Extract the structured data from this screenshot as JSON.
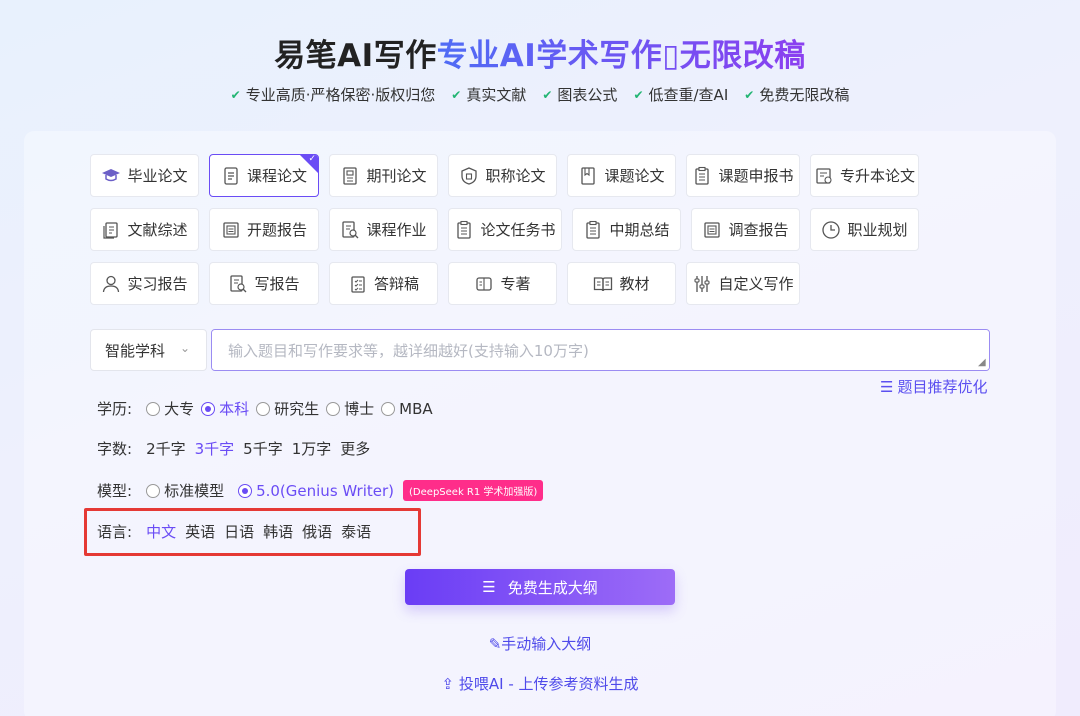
{
  "header": {
    "brand": "易笔AI写作",
    "tagline": "专业AI学术写作▯无限改稿",
    "features": [
      "专业高质·严格保密·版权归您",
      "真实文献",
      "图表公式",
      "低查重/查AI",
      "免费无限改稿"
    ]
  },
  "paper_types": [
    {
      "label": "毕业论文",
      "icon": "graduation-cap-icon",
      "active": false
    },
    {
      "label": "课程论文",
      "icon": "document-icon",
      "active": true
    },
    {
      "label": "期刊论文",
      "icon": "journal-icon",
      "active": false
    },
    {
      "label": "职称论文",
      "icon": "badge-icon",
      "active": false
    },
    {
      "label": "课题论文",
      "icon": "book-icon",
      "active": false
    },
    {
      "label": "课题申报书",
      "icon": "clipboard-icon",
      "active": false
    },
    {
      "label": "专升本论文",
      "icon": "certificate-icon",
      "active": false
    },
    {
      "label": "文献综述",
      "icon": "copy-icon",
      "active": false
    },
    {
      "label": "开题报告",
      "icon": "report-icon",
      "active": false
    },
    {
      "label": "课程作业",
      "icon": "search-document-icon",
      "active": false
    },
    {
      "label": "论文任务书",
      "icon": "checklist-icon",
      "active": false
    },
    {
      "label": "中期总结",
      "icon": "summary-icon",
      "active": false
    },
    {
      "label": "调查报告",
      "icon": "survey-icon",
      "active": false
    },
    {
      "label": "职业规划",
      "icon": "clock-icon",
      "active": false
    },
    {
      "label": "实习报告",
      "icon": "user-icon",
      "active": false
    },
    {
      "label": "写报告",
      "icon": "write-report-icon",
      "active": false
    },
    {
      "label": "答辩稿",
      "icon": "defense-icon",
      "active": false
    },
    {
      "label": "专著",
      "icon": "monograph-icon",
      "active": false
    },
    {
      "label": "教材",
      "icon": "open-book-icon",
      "active": false
    },
    {
      "label": "自定义写作",
      "icon": "sliders-icon",
      "active": false
    }
  ],
  "subject_select": {
    "value": "智能学科"
  },
  "topic": {
    "placeholder": "输入题目和写作要求等，越详细越好(支持输入10万字)"
  },
  "recommend_link": "题目推荐优化",
  "education": {
    "label": "学历:",
    "options": [
      "大专",
      "本科",
      "研究生",
      "博士",
      "MBA"
    ],
    "selected": "本科"
  },
  "word_count": {
    "label": "字数:",
    "options": [
      "2千字",
      "3千字",
      "5千字",
      "1万字",
      "更多"
    ],
    "selected": "3千字"
  },
  "model": {
    "label": "模型:",
    "options": [
      "标准模型",
      "5.0(Genius Writer)"
    ],
    "selected": "5.0(Genius Writer)",
    "badge": "(DeepSeek R1 学术加强版)"
  },
  "language": {
    "label": "语言:",
    "options": [
      "中文",
      "英语",
      "日语",
      "韩语",
      "俄语",
      "泰语"
    ],
    "selected": "中文"
  },
  "actions": {
    "generate": "免费生成大纲",
    "manual_outline": "手动输入大纲",
    "upload": "投喂AI - 上传参考资料生成"
  },
  "colors": {
    "accent": "#6a4cf5",
    "check": "#22b573",
    "badge": "#ff2d8a",
    "highlight_box": "#e53935"
  }
}
